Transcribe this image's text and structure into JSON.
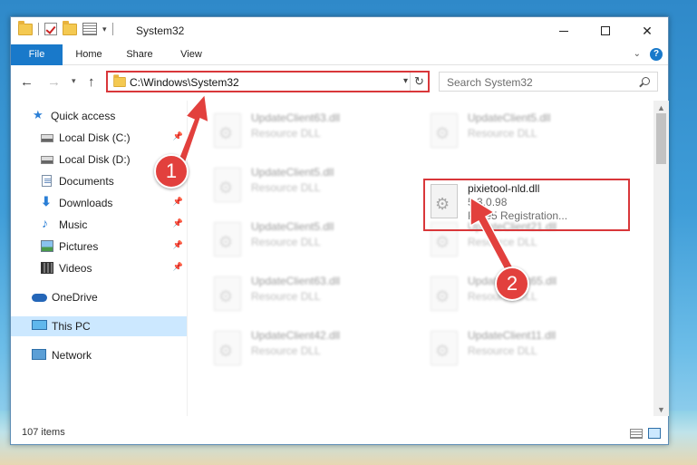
{
  "window": {
    "title": "System32",
    "controls": {
      "minimize": "—",
      "maximize": "□",
      "close": "✕"
    }
  },
  "ribbon": {
    "tabs": [
      "File",
      "Home",
      "Share",
      "View"
    ],
    "help": "?"
  },
  "navigation": {
    "address": "C:\\Windows\\System32",
    "search_placeholder": "Search System32"
  },
  "sidebar": {
    "items": [
      {
        "label": "Quick access",
        "icon": "star-icon",
        "pinned": false
      },
      {
        "label": "Local Disk (C:)",
        "icon": "drive-icon",
        "pinned": true
      },
      {
        "label": "Local Disk (D:)",
        "icon": "drive-icon",
        "pinned": false
      },
      {
        "label": "Documents",
        "icon": "documents-icon",
        "pinned": true
      },
      {
        "label": "Downloads",
        "icon": "download-icon",
        "pinned": true
      },
      {
        "label": "Music",
        "icon": "music-icon",
        "pinned": true
      },
      {
        "label": "Pictures",
        "icon": "pictures-icon",
        "pinned": true
      },
      {
        "label": "Videos",
        "icon": "videos-icon",
        "pinned": true
      },
      {
        "label": "OneDrive",
        "icon": "onedrive-icon",
        "pinned": false
      },
      {
        "label": "This PC",
        "icon": "this-pc-icon",
        "pinned": false,
        "selected": true
      },
      {
        "label": "Network",
        "icon": "network-icon",
        "pinned": false
      }
    ]
  },
  "files": [
    {
      "name": "UpdateClient63.dll",
      "type": "Resource DLL"
    },
    {
      "name": "UpdateClient5.dll",
      "type": "Resource DLL"
    },
    {
      "name": "UpdateClient5.dll",
      "type": "Resource DLL"
    },
    {
      "name": "pixietool-nld.dll",
      "version": "5.3.0.98",
      "description": "Pixie5 Registration..."
    },
    {
      "name": "UpdateClient5.dll",
      "type": "Resource DLL"
    },
    {
      "name": "UpdateClient21.dll",
      "type": "Resource DLL"
    },
    {
      "name": "UpdateClient63.dll",
      "type": "Resource DLL"
    },
    {
      "name": "UpdateClient65.dll",
      "type": "Resource DLL"
    },
    {
      "name": "UpdateClient42.dll",
      "type": "Resource DLL"
    },
    {
      "name": "UpdateClient11.dll",
      "type": "Resource DLL"
    }
  ],
  "status": {
    "items": "107 items"
  },
  "annotations": {
    "step1": "1",
    "step2": "2"
  },
  "colors": {
    "accent": "#1979ca",
    "highlight": "#d9373a",
    "selected": "#cce8ff"
  }
}
